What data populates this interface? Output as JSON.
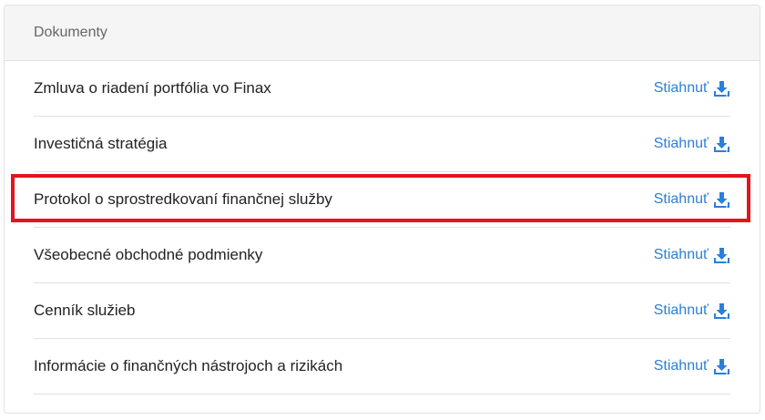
{
  "panel": {
    "title": "Dokumenty"
  },
  "documents": [
    {
      "name": "Zmluva o riadení portfólia vo Finax",
      "action": "Stiahnuť"
    },
    {
      "name": "Investičná stratégia",
      "action": "Stiahnuť"
    },
    {
      "name": "Protokol o sprostredkovaní finančnej služby",
      "action": "Stiahnuť"
    },
    {
      "name": "Všeobecné obchodné podmienky",
      "action": "Stiahnuť"
    },
    {
      "name": "Cenník služieb",
      "action": "Stiahnuť"
    },
    {
      "name": "Informácie o finančných nástrojoch a rizikách",
      "action": "Stiahnuť"
    }
  ],
  "icons": {
    "download": "download-icon"
  },
  "colors": {
    "link": "#2b7fd8",
    "highlight": "#e3141e",
    "header_bg": "#f5f5f5"
  }
}
